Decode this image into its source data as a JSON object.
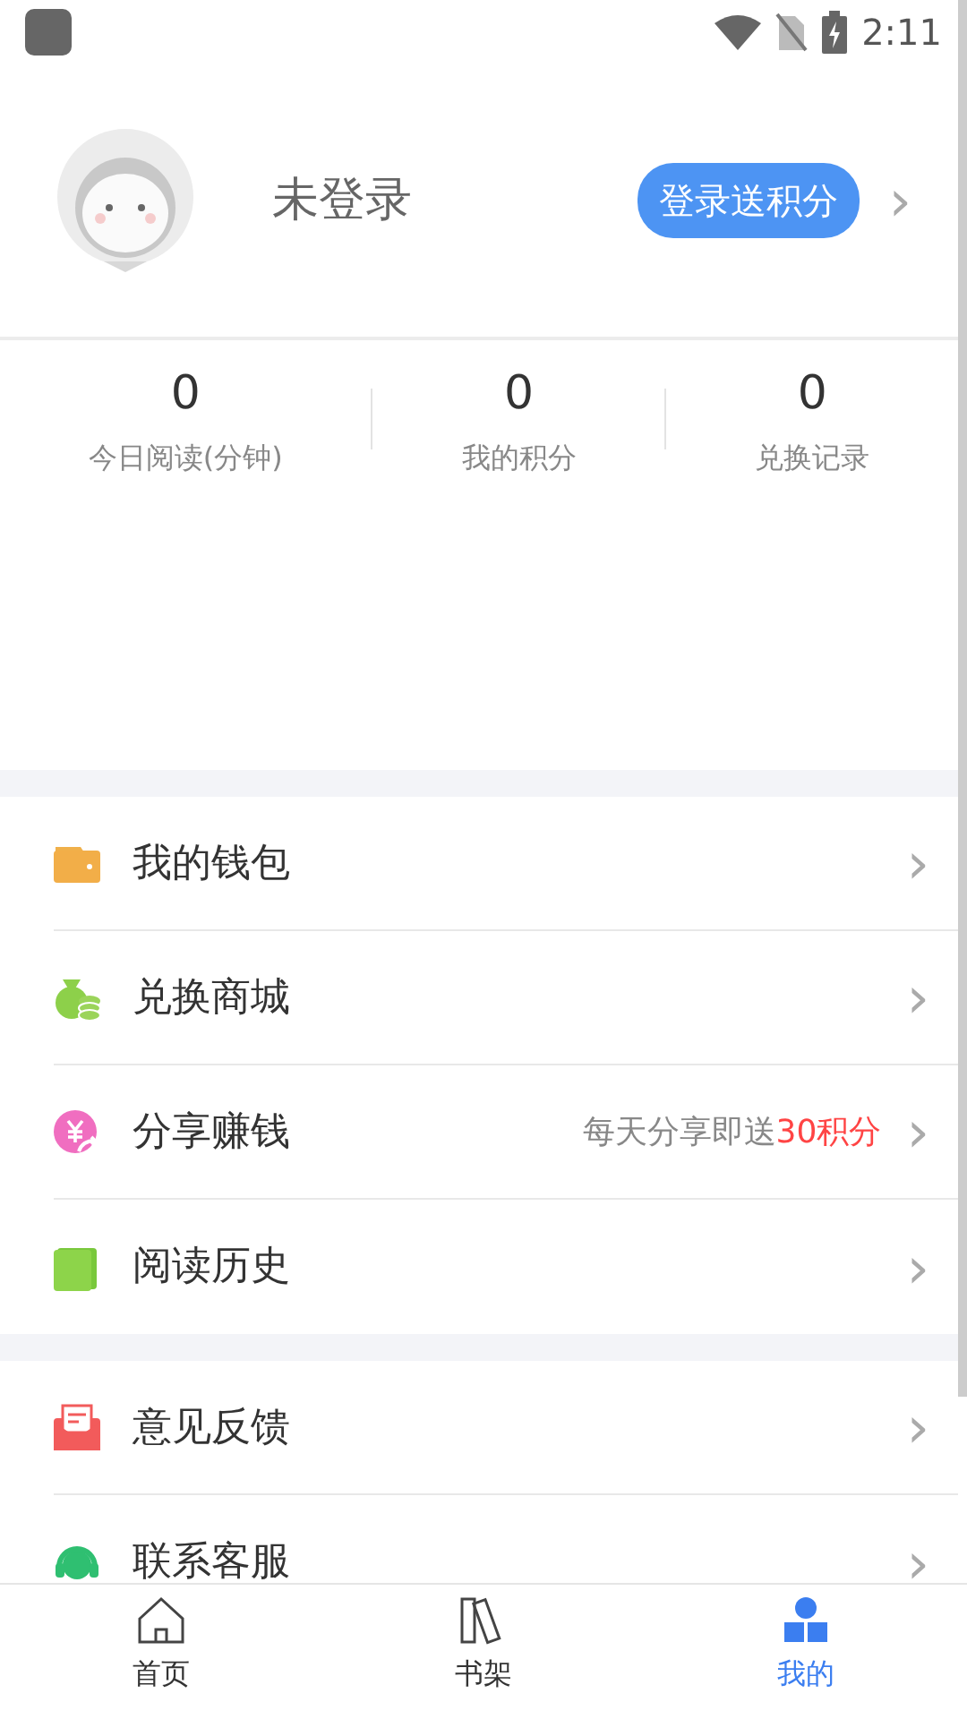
{
  "status_bar": {
    "time": "2:11"
  },
  "profile": {
    "name": "未登录",
    "login_button": "登录送积分",
    "chevron": "›"
  },
  "stats": [
    {
      "value": "0",
      "label": "今日阅读(分钟)"
    },
    {
      "value": "0",
      "label": "我的积分"
    },
    {
      "value": "0",
      "label": "兑换记录"
    }
  ],
  "menu_groups": [
    {
      "items": [
        {
          "label": "我的钱包",
          "chevron": "›"
        },
        {
          "label": "兑换商城",
          "chevron": "›"
        },
        {
          "label": "分享赚钱",
          "note": "每天分享即送",
          "note_highlight": "30积分",
          "chevron": "›"
        },
        {
          "label": "阅读历史",
          "chevron": "›"
        }
      ]
    },
    {
      "items": [
        {
          "label": "意见反馈",
          "chevron": "›"
        },
        {
          "label": "联系客服",
          "chevron": "›"
        }
      ]
    }
  ],
  "bottom_nav": [
    {
      "label": "首页",
      "selected": false
    },
    {
      "label": "书架",
      "selected": false
    },
    {
      "label": "我的",
      "selected": true
    }
  ]
}
